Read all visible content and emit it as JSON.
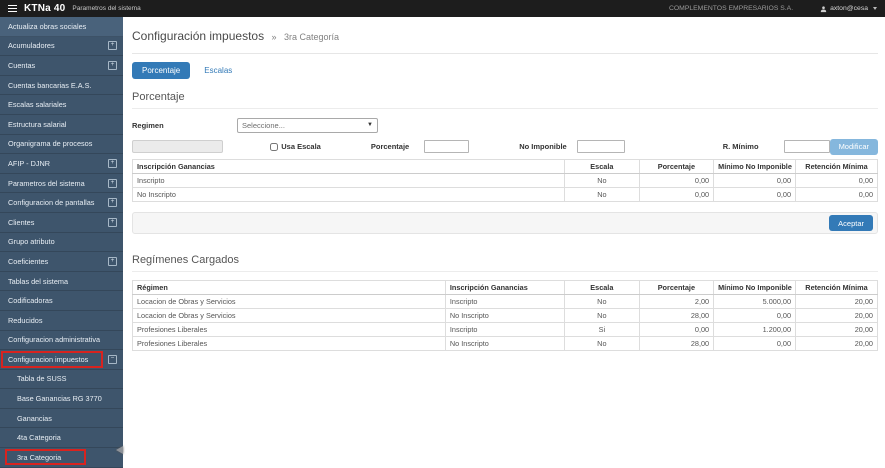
{
  "topbar": {
    "brand": "KTNa 40",
    "brand_sub": "Parametros del sistema",
    "company": "COMPLEMENTOS EMPRESARIOS S.A.",
    "user": "axton@cesa"
  },
  "sidebar": {
    "items": [
      {
        "label": "Actualiza obras sociales",
        "expand": null,
        "sub": false,
        "highlight": false,
        "hover": true
      },
      {
        "label": "Acumuladores",
        "expand": "plus",
        "sub": false,
        "highlight": false,
        "hover": false
      },
      {
        "label": "Cuentas",
        "expand": "plus",
        "sub": false,
        "highlight": false,
        "hover": false
      },
      {
        "label": "Cuentas bancarias E.A.S.",
        "expand": null,
        "sub": false,
        "highlight": false,
        "hover": false
      },
      {
        "label": "Escalas salariales",
        "expand": null,
        "sub": false,
        "highlight": false,
        "hover": false
      },
      {
        "label": "Estructura salarial",
        "expand": null,
        "sub": false,
        "highlight": false,
        "hover": false
      },
      {
        "label": "Organigrama de procesos",
        "expand": null,
        "sub": false,
        "highlight": false,
        "hover": false
      },
      {
        "label": "AFIP - DJNR",
        "expand": "plus",
        "sub": false,
        "highlight": false,
        "hover": false
      },
      {
        "label": "Parametros del sistema",
        "expand": "plus",
        "sub": false,
        "highlight": false,
        "hover": false
      },
      {
        "label": "Configuracion de pantallas",
        "expand": "plus",
        "sub": false,
        "highlight": false,
        "hover": false
      },
      {
        "label": "Clientes",
        "expand": "plus",
        "sub": false,
        "highlight": false,
        "hover": false
      },
      {
        "label": "Grupo atributo",
        "expand": null,
        "sub": false,
        "highlight": false,
        "hover": false
      },
      {
        "label": "Coeficientes",
        "expand": "plus",
        "sub": false,
        "highlight": false,
        "hover": false
      },
      {
        "label": "Tablas del sistema",
        "expand": null,
        "sub": false,
        "highlight": false,
        "hover": false
      },
      {
        "label": "Codificadoras",
        "expand": null,
        "sub": false,
        "highlight": false,
        "hover": false
      },
      {
        "label": "Reducidos",
        "expand": null,
        "sub": false,
        "highlight": false,
        "hover": false
      },
      {
        "label": "Configuracion administrativa",
        "expand": null,
        "sub": false,
        "highlight": false,
        "hover": false
      },
      {
        "label": "Configuracion impuestos",
        "expand": "minus",
        "sub": false,
        "highlight": true,
        "hover": false
      },
      {
        "label": "Tabla de SUSS",
        "expand": null,
        "sub": true,
        "highlight": false,
        "hover": false
      },
      {
        "label": "Base Ganancias RG 3770",
        "expand": null,
        "sub": true,
        "highlight": false,
        "hover": false
      },
      {
        "label": "Ganancias",
        "expand": null,
        "sub": true,
        "highlight": false,
        "hover": false
      },
      {
        "label": "4ta Categoria",
        "expand": null,
        "sub": true,
        "highlight": false,
        "hover": false
      },
      {
        "label": "3ra Categoria",
        "expand": null,
        "sub": true,
        "highlight": true,
        "hover": false
      }
    ]
  },
  "main": {
    "title": "Configuración impuestos",
    "breadcrumb_separator": "»",
    "breadcrumb_current": "3ra Categoría",
    "tabs": {
      "porcentaje": "Porcentaje",
      "escalas": "Escalas"
    },
    "section_percentage": {
      "heading": "Porcentaje",
      "form": {
        "regimen_label": "Regimen",
        "regimen_selected": "Seleccione...",
        "usa_escala_label": "Usa Escala",
        "porcentaje_label": "Porcentaje",
        "porcentaje_value": "",
        "no_imponible_label": "No Imponible",
        "no_imponible_value": "",
        "r_minimo_label": "R. Mínimo",
        "r_minimo_value": "",
        "modificar_button": "Modificar"
      },
      "table": {
        "headers": [
          "Inscripción Ganancias",
          "Escala",
          "Porcentaje",
          "Mínimo No Imponible",
          "Retención Mínima"
        ],
        "rows": [
          [
            "Inscripto",
            "No",
            "0,00",
            "0,00",
            "0,00"
          ],
          [
            "No Inscripto",
            "No",
            "0,00",
            "0,00",
            "0,00"
          ]
        ]
      },
      "aceptar_button": "Aceptar"
    },
    "section_loaded": {
      "heading": "Regímenes Cargados",
      "table": {
        "headers": [
          "Régimen",
          "Inscripción Ganancias",
          "Escala",
          "Porcentaje",
          "Mínimo No Imponible",
          "Retención Mínima"
        ],
        "rows": [
          [
            "Locacion de Obras y Servicios",
            "Inscripto",
            "No",
            "2,00",
            "5.000,00",
            "20,00"
          ],
          [
            "Locacion de Obras y Servicios",
            "No Inscripto",
            "No",
            "28,00",
            "0,00",
            "20,00"
          ],
          [
            "Profesiones Liberales",
            "Inscripto",
            "Si",
            "0,00",
            "1.200,00",
            "20,00"
          ],
          [
            "Profesiones Liberales",
            "No Inscripto",
            "No",
            "28,00",
            "0,00",
            "20,00"
          ]
        ]
      }
    }
  },
  "colors": {
    "accent_blue": "#337ab7",
    "highlight_red": "#d8231f",
    "topbar_bg": "#1d1d1d",
    "sidebar_bg": "#3e556c"
  }
}
